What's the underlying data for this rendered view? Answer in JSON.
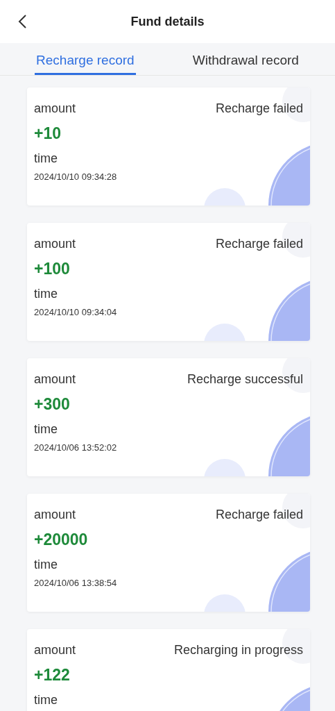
{
  "header": {
    "title": "Fund details"
  },
  "tabs": [
    {
      "label": "Recharge record",
      "selected": true
    },
    {
      "label": "Withdrawal record",
      "selected": false
    }
  ],
  "records": [
    {
      "amount_label": "amount",
      "status": "Recharge failed",
      "amount": "+10",
      "time_label": "time",
      "time": "2024/10/10 09:34:28"
    },
    {
      "amount_label": "amount",
      "status": "Recharge failed",
      "amount": "+100",
      "time_label": "time",
      "time": "2024/10/10 09:34:04"
    },
    {
      "amount_label": "amount",
      "status": "Recharge successful",
      "amount": "+300",
      "time_label": "time",
      "time": "2024/10/06 13:52:02"
    },
    {
      "amount_label": "amount",
      "status": "Recharge failed",
      "amount": "+20000",
      "time_label": "time",
      "time": "2024/10/06 13:38:54"
    },
    {
      "amount_label": "amount",
      "status": "Recharging in progress",
      "amount": "+122",
      "time_label": "time"
    }
  ]
}
